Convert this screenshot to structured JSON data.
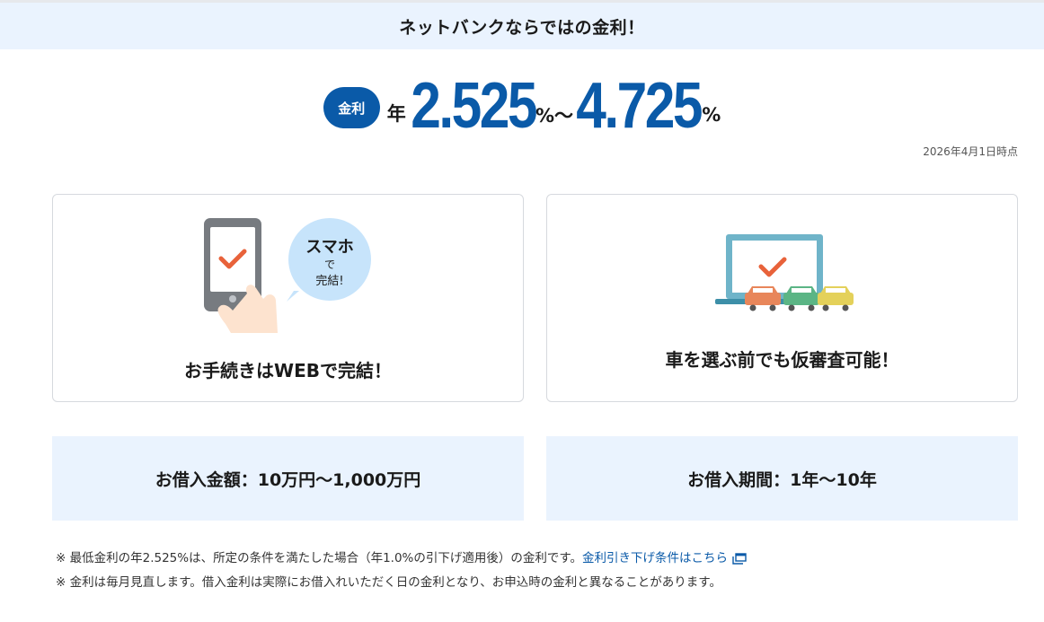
{
  "headline": "ネットバンクならではの金利！",
  "rate": {
    "badge": "金利",
    "prefix": "年",
    "min": "2.525",
    "min_unit": "%～",
    "max": "4.725",
    "max_unit": "%",
    "as_of": "2026年4月1日時点"
  },
  "features": {
    "web": {
      "title": "お手続きはWEBで完結！",
      "bubble_line1": "スマホ",
      "bubble_line2": "で",
      "bubble_line3": "完結!"
    },
    "screening": {
      "title": "車を選ぶ前でも仮審査可能！"
    }
  },
  "loan_amount": "お借入金額：10万円～1,000万円",
  "loan_period": "お借入期間：1年～10年",
  "notes": {
    "note1_text": "※ 最低金利の年2.525%は、所定の条件を満たした場合（年1.0%の引下げ適用後）の金利です。",
    "note1_link": "金利引き下げ条件はこちら",
    "note2_text": "※ 金利は毎月見直します。借入金利は実際にお借入れいただく日の金利となり、お申込時の金利と異なることがあります。"
  },
  "colors": {
    "accent": "#0a5aa8",
    "panel_bg": "#eaf3fe",
    "check": "#e8623a"
  }
}
